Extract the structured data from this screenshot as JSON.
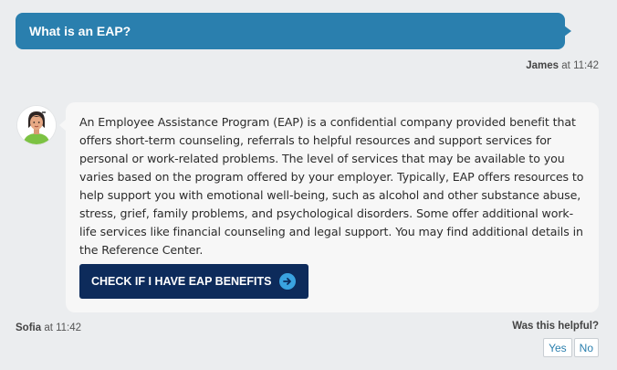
{
  "user_message": {
    "text": "What is an EAP?",
    "sender": "James",
    "time": "at 11:42"
  },
  "bot_message": {
    "text": "An Employee Assistance Program (EAP) is a confidential company provided benefit that offers short-term counseling, referrals to helpful resources and support services for personal or work-related problems. The level of services that may be available to you varies based on the program offered by your employer. Typically, EAP offers resources to help support you with emotional well-being, such as alcohol and other substance abuse, stress, grief, family problems, and psychological disorders. Some offer additional work-life services like financial counseling and legal support. You may find additional details in the Reference Center.",
    "cta_label": "CHECK IF I HAVE EAP BENEFITS",
    "sender": "Sofia",
    "time": "at 11:42"
  },
  "feedback": {
    "question": "Was this helpful?",
    "yes_label": "Yes",
    "no_label": "No"
  },
  "colors": {
    "user_bubble": "#2a7fae",
    "cta_background": "#0d2b5b",
    "cta_arrow": "#3aa3e0",
    "page_background": "#ebedef"
  },
  "icons": {
    "cta_icon": "arrow-right-circle-icon",
    "avatar": "sofia-avatar"
  }
}
